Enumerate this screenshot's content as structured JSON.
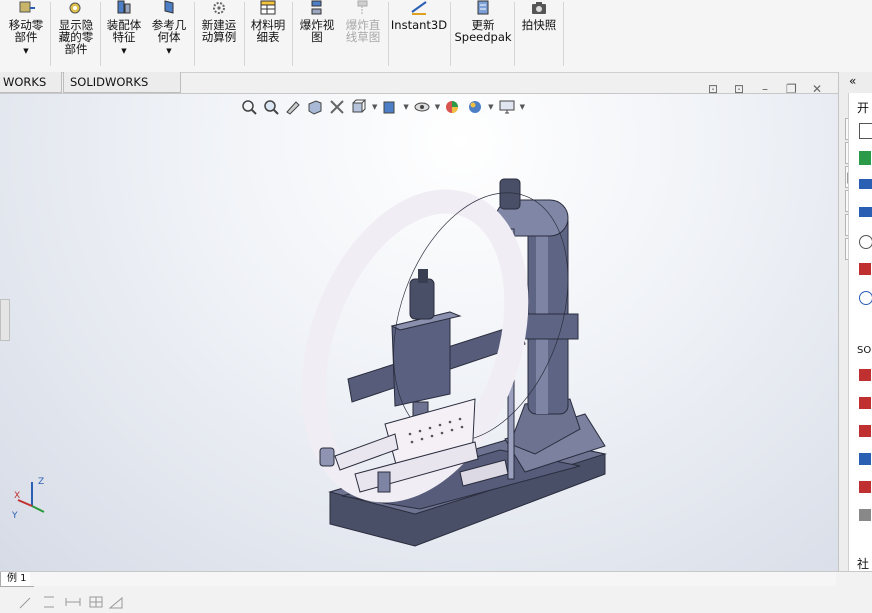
{
  "ribbon": {
    "buttons": [
      {
        "id": "move-component",
        "label": "移动零\n部件",
        "has_arrow": true,
        "enabled": true
      },
      {
        "id": "show-hidden",
        "label": "显示隐\n藏的零\n部件",
        "has_arrow": false,
        "enabled": true
      },
      {
        "id": "assembly-feature",
        "label": "装配体\n特征",
        "has_arrow": true,
        "enabled": true
      },
      {
        "id": "reference-geometry",
        "label": "参考几\n何体",
        "has_arrow": true,
        "enabled": true
      },
      {
        "id": "new-motion-study",
        "label": "新建运\n动算例",
        "has_arrow": false,
        "enabled": true
      },
      {
        "id": "bill-of-materials",
        "label": "材料明\n细表",
        "has_arrow": false,
        "enabled": true
      },
      {
        "id": "exploded-view",
        "label": "爆炸视\n图",
        "has_arrow": false,
        "enabled": true
      },
      {
        "id": "explode-line-sketch",
        "label": "爆炸直\n线草图",
        "has_arrow": false,
        "enabled": false
      },
      {
        "id": "instant3d",
        "label": "Instant3D",
        "has_arrow": false,
        "enabled": true
      },
      {
        "id": "update-speedpak",
        "label": "更新\nSpeedpak",
        "has_arrow": false,
        "enabled": true
      },
      {
        "id": "snapshot",
        "label": "拍快照",
        "has_arrow": false,
        "enabled": true
      }
    ]
  },
  "tabs": [
    "WORKS 插件",
    "SOLIDWORKS MBD"
  ],
  "task_pane": {
    "header_text": "开",
    "section_text": "SO",
    "footer_text": "社"
  },
  "bottom": {
    "tab_label": "例 1"
  },
  "triad": {
    "x": "X",
    "y": "Y",
    "z": "Z"
  },
  "colors": {
    "accent": "#2b5fb4",
    "ring": "#f2eef4",
    "model": "#5a5f7a"
  }
}
